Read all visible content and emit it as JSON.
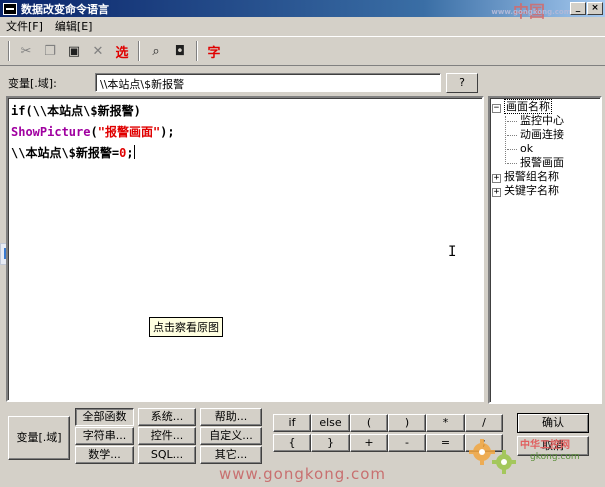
{
  "window": {
    "title": "数据改变命令语言",
    "watermark_top": "中国",
    "watermark_top_url": "www.gongkong.com"
  },
  "menu": [
    "文件[F]",
    "编辑[E]"
  ],
  "toolbar": {
    "icons": [
      "cut-icon",
      "copy-icon",
      "paste-icon",
      "delete-icon",
      "select-icon",
      "find-icon",
      "replace-icon",
      "font-icon"
    ],
    "select_label": "选",
    "font_label": "字"
  },
  "variable_row": {
    "label": "变量[.域]:",
    "value": "\\\\本站点\\$新报警",
    "browse_label": "?"
  },
  "editor": {
    "line1_a": "if(",
    "line1_b": "\\\\本站点\\$新报警",
    "line1_c": ")",
    "line2_func": "ShowPicture",
    "line2_open": "(",
    "line2_arg": "\"报警画面\"",
    "line2_close": ");",
    "line3_var": "\\\\本站点\\$新报警",
    "line3_op": "=",
    "line3_num": "0",
    "line3_end": ";",
    "tooltip": "点击察看原图"
  },
  "tree": {
    "nodes": [
      {
        "label": "画面名称",
        "expanded": true,
        "children": [
          "监控中心",
          "动画连接",
          "ok",
          "报警画面"
        ]
      },
      {
        "label": "报警组名称",
        "expanded": false
      },
      {
        "label": "关键字名称",
        "expanded": false
      }
    ]
  },
  "bottom": {
    "var_button": "变量[.域]",
    "func_buttons": [
      "全部函数",
      "系统...",
      "帮助...",
      "字符串...",
      "控件...",
      "自定义...",
      "数学...",
      "SQL...",
      "其它..."
    ],
    "op_row1": [
      "if",
      "else",
      "(",
      ")",
      "*",
      "/"
    ],
    "op_row2": [
      "{",
      "}",
      "+",
      "-",
      "=",
      ";"
    ],
    "ok": "确认",
    "cancel": "取消"
  },
  "watermark": {
    "bottom_url": "www.gongkong.com",
    "logo_text": "中华工控网",
    "logo_sub": "gkong.com"
  }
}
